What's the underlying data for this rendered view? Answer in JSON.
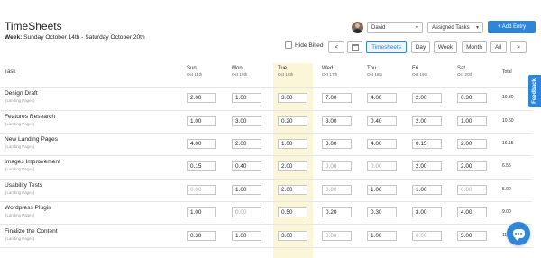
{
  "header": {
    "title": "TimeSheets",
    "week_label": "Week:",
    "week_range": "Sunday October 14th - Saturday October 20th"
  },
  "toolbar": {
    "user": "David",
    "filter": "Assigned Tasks",
    "add_entry": "+ Add Entry",
    "hide_billed": "Hide Billed",
    "prev": "<",
    "next": ">",
    "views": [
      "Timesheets",
      "Day",
      "Week",
      "Month",
      "All"
    ]
  },
  "columns": {
    "task": "Task",
    "total": "Total",
    "days": [
      {
        "name": "Sun",
        "date": "Oct 14th"
      },
      {
        "name": "Mon",
        "date": "Oct 15th"
      },
      {
        "name": "Tue",
        "date": "Oct 16th"
      },
      {
        "name": "Wed",
        "date": "Oct 17th"
      },
      {
        "name": "Thu",
        "date": "Oct 18th"
      },
      {
        "name": "Fri",
        "date": "Oct 19th"
      },
      {
        "name": "Sat",
        "date": "Oct 20th"
      }
    ]
  },
  "rows": [
    {
      "task": "Design Draft",
      "project": "(Landing Pages)",
      "values": [
        "2.00",
        "1.00",
        "3.00",
        "7.00",
        "4.00",
        "2.00",
        "0.30"
      ],
      "placeholder": [
        false,
        false,
        false,
        false,
        false,
        false,
        false
      ],
      "total": "19.30"
    },
    {
      "task": "Features Research",
      "project": "(Landing Pages)",
      "values": [
        "1.00",
        "3.00",
        "0.20",
        "3.00",
        "0.40",
        "2.00",
        "1.00"
      ],
      "placeholder": [
        false,
        false,
        false,
        false,
        false,
        false,
        false
      ],
      "total": "10.60"
    },
    {
      "task": "New Landing Pages",
      "project": "(Landing Pages)",
      "values": [
        "4.00",
        "2.00",
        "1.00",
        "3.00",
        "4.00",
        "0.15",
        "2.00"
      ],
      "placeholder": [
        false,
        false,
        false,
        false,
        false,
        false,
        false
      ],
      "total": "16.15"
    },
    {
      "task": "Images Improvement",
      "project": "(Landing Pages)",
      "values": [
        "0.15",
        "0.40",
        "2.00",
        "0.00",
        "0.00",
        "2.00",
        "2.00"
      ],
      "placeholder": [
        false,
        false,
        false,
        true,
        true,
        false,
        false
      ],
      "total": "6.55"
    },
    {
      "task": "Usability Tests",
      "project": "(Landing Pages)",
      "values": [
        "0.00",
        "1.00",
        "2.00",
        "0.00",
        "1.00",
        "1.00",
        "0.00"
      ],
      "placeholder": [
        true,
        false,
        false,
        true,
        false,
        false,
        true
      ],
      "total": "5.00"
    },
    {
      "task": "Wordpress Plugin",
      "project": "(Landing Pages)",
      "values": [
        "1.00",
        "0.00",
        "0.50",
        "0.20",
        "0.30",
        "3.00",
        "4.00"
      ],
      "placeholder": [
        false,
        true,
        false,
        false,
        false,
        false,
        false
      ],
      "total": "9.00"
    },
    {
      "task": "Finalize the Content",
      "project": "(Landing Pages)",
      "values": [
        "0.30",
        "1.00",
        "3.00",
        "0.00",
        "1.00",
        "0.00",
        "5.00"
      ],
      "placeholder": [
        false,
        false,
        false,
        true,
        false,
        true,
        false
      ],
      "total": "11."
    }
  ],
  "feedback_label": "Feedback",
  "colors": {
    "accent": "#2f86d9",
    "today_column": "#fcf6d9"
  }
}
